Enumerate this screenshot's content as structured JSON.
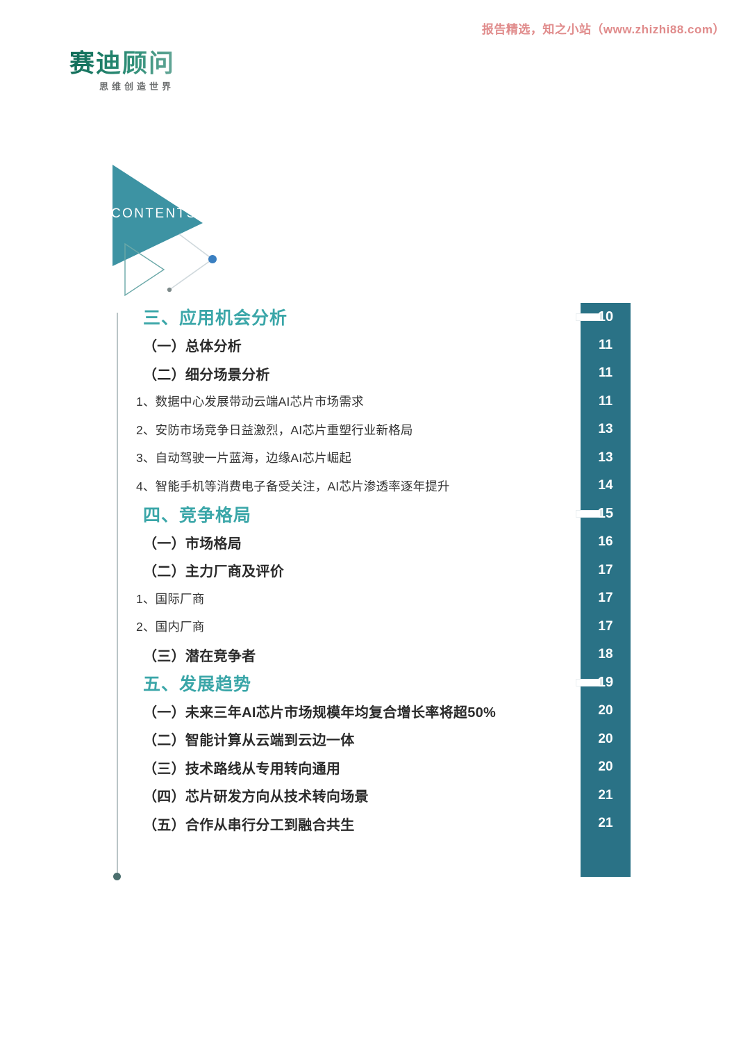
{
  "watermark": {
    "text": "报告精选，知之小站（www.zhizhi88.com）",
    "color": "#e08b8b"
  },
  "logo": {
    "name": "赛迪顾问",
    "tagline": "思维创造世界",
    "color": "#1f7a63"
  },
  "contents_graphic": {
    "label": "CONTENTS",
    "fill_color": "#3d93a3",
    "outline_color": "#6aa8a8",
    "dot_color": "#3a7fc1",
    "small_dot_color": "#7d8a8a"
  },
  "panel": {
    "color": "#2a7286",
    "notch_color": "#ffffff"
  },
  "colors": {
    "section_heading": "#3aa6a8",
    "sub_heading": "#2a2a2a",
    "item_text": "#333333",
    "guide_line": "#b9c4c6"
  },
  "toc": {
    "entries": [
      {
        "level": "section",
        "label": "三、应用机会分析",
        "page": "10",
        "marker": true
      },
      {
        "level": "sub",
        "label": "（一）总体分析",
        "page": "11",
        "marker": false
      },
      {
        "level": "sub",
        "label": "（二）细分场景分析",
        "page": "11",
        "marker": false
      },
      {
        "level": "item",
        "label": "1、数据中心发展带动云端AI芯片市场需求",
        "page": "11",
        "marker": false
      },
      {
        "level": "item",
        "label": "2、安防市场竞争日益激烈，AI芯片重塑行业新格局",
        "page": "13",
        "marker": false
      },
      {
        "level": "item",
        "label": "3、自动驾驶一片蓝海，边缘AI芯片崛起",
        "page": "13",
        "marker": false
      },
      {
        "level": "item",
        "label": "4、智能手机等消费电子备受关注，AI芯片渗透率逐年提升",
        "page": "14",
        "marker": false
      },
      {
        "level": "section",
        "label": "四、竞争格局",
        "page": "15",
        "marker": true
      },
      {
        "level": "sub",
        "label": "（一）市场格局",
        "page": "16",
        "marker": false
      },
      {
        "level": "sub",
        "label": "（二）主力厂商及评价",
        "page": "17",
        "marker": false
      },
      {
        "level": "item",
        "label": "1、国际厂商",
        "page": "17",
        "marker": false
      },
      {
        "level": "item",
        "label": "2、国内厂商",
        "page": "17",
        "marker": false
      },
      {
        "level": "sub",
        "label": "（三）潜在竞争者",
        "page": "18",
        "marker": false
      },
      {
        "level": "section",
        "label": "五、发展趋势",
        "page": "19",
        "marker": true
      },
      {
        "level": "sub",
        "label": "（一）未来三年AI芯片市场规模年均复合增长率将超50%",
        "page": "20",
        "marker": false
      },
      {
        "level": "sub",
        "label": "（二）智能计算从云端到云边一体",
        "page": "20",
        "marker": false
      },
      {
        "level": "sub",
        "label": "（三）技术路线从专用转向通用",
        "page": "20",
        "marker": false
      },
      {
        "level": "sub",
        "label": "（四）芯片研发方向从技术转向场景",
        "page": "21",
        "marker": false
      },
      {
        "level": "sub",
        "label": "（五）合作从串行分工到融合共生",
        "page": "21",
        "marker": false
      }
    ]
  }
}
